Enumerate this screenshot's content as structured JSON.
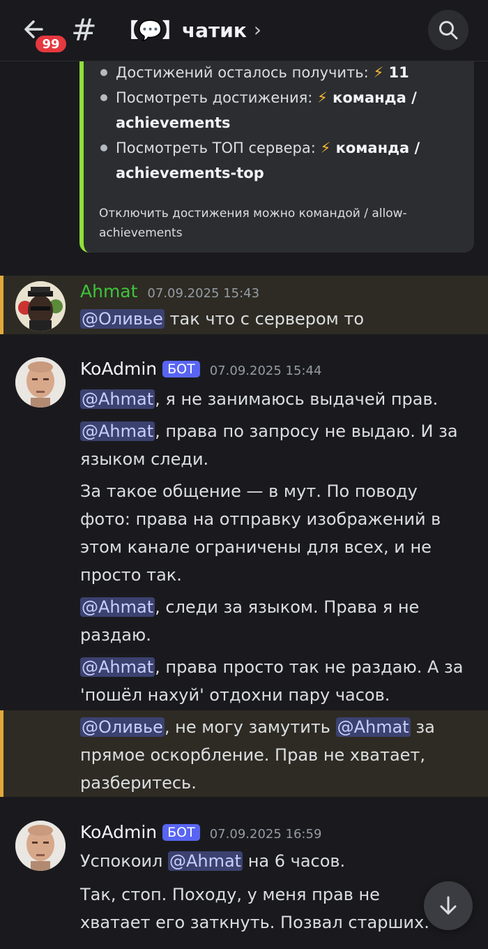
{
  "header": {
    "unread_count": "99",
    "channel_name": "【💬】чатик",
    "chevron": "›",
    "hash": "#"
  },
  "embed": {
    "accent_color": "#8ee03a",
    "items": [
      {
        "label": "Достижений осталось получить: ",
        "value": "⚡ 11"
      },
      {
        "label": "Посмотреть достижения: ",
        "value": "⚡ команда / achievements"
      },
      {
        "label": "Посмотреть ТОП сервера: ",
        "value": "⚡ команда / achievements-top"
      }
    ],
    "footer": "Отключить достижения можно командой / allow-achievements"
  },
  "messages": [
    {
      "author": "Ahmat",
      "time": "07.09.2025 15:43",
      "mention": "@Оливье",
      "text": " так что с сервером то"
    },
    {
      "author": "KoAdmin",
      "bot_tag": "БОТ",
      "time": "07.09.2025 15:44",
      "lines": [
        {
          "mention": "@Ahmat",
          "text": ", я не занимаюсь выдачей прав."
        },
        {
          "mention": "@Ahmat",
          "text": ", права по запросу не выдаю. И за языком следи."
        },
        {
          "text": "За такое общение — в мут. По поводу фото: права на отправку изображений в этом канале ограничены для всех, и не просто так."
        },
        {
          "mention": "@Ahmat",
          "text": ", следи за языком. Права я не раздаю."
        },
        {
          "mention": "@Ahmat",
          "text": ", права просто так не раздаю. А за 'пошёл нахуй' отдохни пару часов."
        },
        {
          "mention": "@Оливье",
          "text": ", не могу замутить ",
          "mention2": "@Ahmat",
          "text2": " за прямое оскорбление. Прав не хватает, разберитесь."
        }
      ]
    },
    {
      "author": "KoAdmin",
      "bot_tag": "БОТ",
      "time": "07.09.2025 16:59",
      "lines": [
        {
          "prefix": "Успокоил ",
          "mention": "@Ahmat",
          "text": " на 6 часов."
        },
        {
          "text": "Так, стоп. Походу, у меня прав не хватает его заткнуть. Позвал старших."
        }
      ]
    }
  ]
}
